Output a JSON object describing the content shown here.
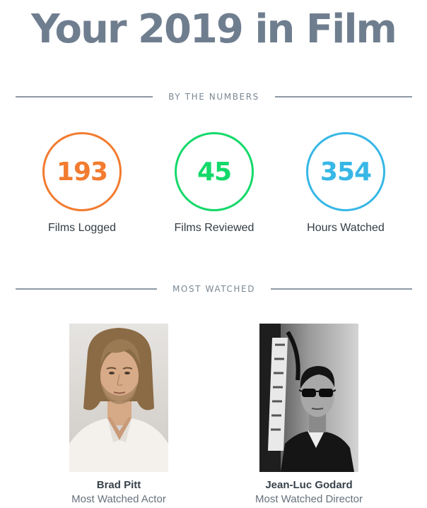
{
  "header": {
    "title": "Your 2019 in Film"
  },
  "sections": {
    "numbers_label": "BY THE NUMBERS",
    "most_watched_label": "MOST WATCHED"
  },
  "stats": [
    {
      "value": "193",
      "label": "Films Logged",
      "color": "#f27b2f"
    },
    {
      "value": "45",
      "label": "Films Reviewed",
      "color": "#14d96a"
    },
    {
      "value": "354",
      "label": "Hours Watched",
      "color": "#37b7e6"
    }
  ],
  "most_watched": [
    {
      "name": "Brad Pitt",
      "role": "Most Watched Actor"
    },
    {
      "name": "Jean-Luc Godard",
      "role": "Most Watched Director"
    }
  ],
  "colors": {
    "title": "#6f7e8f",
    "rule": "#8e99a4"
  }
}
